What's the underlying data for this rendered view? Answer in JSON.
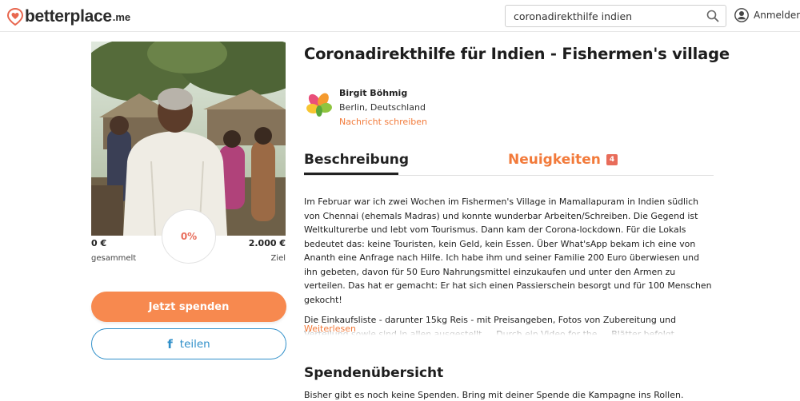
{
  "header": {
    "logo_text": "betterplace",
    "logo_suffix": ".me",
    "search_value": "coronadirekthilfe indien",
    "search_icon": "search-icon",
    "login_label": "Anmelden",
    "accent": "#f27a3a"
  },
  "campaign": {
    "title": "Coronadirekthilfe für Indien - Fishermen's village",
    "raised_amount": "0 €",
    "raised_label": "gesammelt",
    "goal_amount": "2.000 €",
    "goal_label": "Ziel",
    "progress_text": "0%",
    "progress_fraction": 0,
    "donate_label": "Jetzt spenden",
    "share_label": "teilen"
  },
  "organizer": {
    "name": "Birgit Böhmig",
    "location": "Berlin, Deutschland",
    "message_link": "Nachricht schreiben"
  },
  "tabs": {
    "description": "Beschreibung",
    "news": "Neuigkeiten",
    "news_count": "4"
  },
  "description": {
    "paragraph1": "Im Februar war ich zwei Wochen im Fishermen's Village in Mamallapuram in Indien südlich von Chennai (ehemals Madras) und konnte wunderbar Arbeiten/Schreiben. Die Gegend ist Weltkulturerbe und lebt vom Tourismus. Dann kam der Corona-lockdown. Für die Lokals bedeutet das: keine Touristen, kein Geld, kein Essen. Über What'sApp bekam ich eine von Ananth eine Anfrage nach Hilfe. Ich habe ihm und seiner Familie 200 Euro überwiesen und ihn gebeten, davon für 50 Euro Nahrungsmittel einzukaufen und unter den Armen zu verteilen. Das hat er gemacht: Er hat sich einen Passierschein besorgt und für 100 Menschen gekocht!",
    "paragraph2": "Die Einkaufsliste - darunter 15kg Reis - mit Preisangeben, Fotos von Zubereitung und Verteilung sowie sind in allen ausgestellt … Durch ein Video for the … Blätter befolgt …",
    "read_more": "Weiterlesen"
  },
  "donations": {
    "title": "Spendenübersicht",
    "empty_text": "Bisher gibt es noch keine Spenden. Bring mit deiner Spende die Kampagne ins Rollen."
  }
}
